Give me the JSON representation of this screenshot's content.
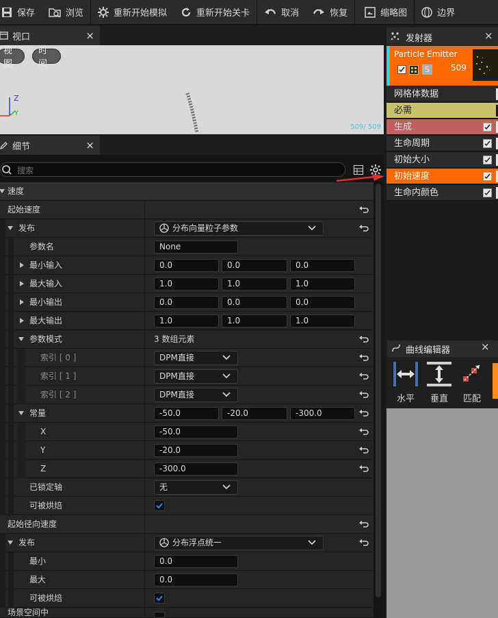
{
  "toolbar": {
    "items": [
      {
        "label": "保存",
        "icon": "save-icon"
      },
      {
        "label": "浏览",
        "icon": "browse-icon"
      },
      {
        "label": "重新开始模拟",
        "icon": "restart-sim-icon"
      },
      {
        "label": "重新开始关卡",
        "icon": "restart-level-icon"
      },
      {
        "label": "取消",
        "icon": "undo-icon"
      },
      {
        "label": "恢复",
        "icon": "redo-icon"
      },
      {
        "label": "缩略图",
        "icon": "thumbnail-icon"
      },
      {
        "label": "边界",
        "icon": "bounds-icon"
      }
    ]
  },
  "viewport": {
    "tab_title": "视口",
    "view_button": "视图",
    "time_button": "时间",
    "axis_z": "Z",
    "axis_y": "Y",
    "counter": "509/ 509"
  },
  "details": {
    "tab_title": "细节",
    "search_placeholder": "搜索",
    "section_velocity": "速度",
    "start_velocity": "起始速度",
    "distribution": "发布",
    "distribution_value": "分布向量粒子参数",
    "param_name": "参数名",
    "param_name_value": "None",
    "min_input": "最小输入",
    "min_input_values": [
      "0.0",
      "0.0",
      "0.0"
    ],
    "max_input": "最大输入",
    "max_input_values": [
      "1.0",
      "1.0",
      "1.0"
    ],
    "min_output": "最小输出",
    "min_output_values": [
      "0.0",
      "0.0",
      "0.0"
    ],
    "max_output": "最大输出",
    "max_output_values": [
      "1.0",
      "1.0",
      "1.0"
    ],
    "param_modes": "参数模式",
    "param_modes_value": "3 数组元素",
    "indices": [
      {
        "label": "索引 [ 0 ]",
        "value": "DPM直接"
      },
      {
        "label": "索引 [ 1 ]",
        "value": "DPM直接"
      },
      {
        "label": "索引 [ 2 ]",
        "value": "DPM直接"
      }
    ],
    "constant": "常量",
    "constant_values": [
      "-50.0",
      "-20.0",
      "-300.0"
    ],
    "x_label": "X",
    "x_value": "-50.0",
    "y_label": "Y",
    "y_value": "-20.0",
    "z_label": "Z",
    "z_value": "-300.0",
    "locked_axis": "已锁定轴",
    "locked_axis_value": "无",
    "can_bake": "可被烘焙",
    "start_radial": "起始径向速度",
    "radial_distribution": "发布",
    "radial_distribution_value": "分布浮点统一",
    "min_label": "最小",
    "min_value": "0.0",
    "max_label": "最大",
    "max_value": "0.0",
    "can_bake_2": "可被烘焙",
    "scene_space": "场景空间中"
  },
  "emitter": {
    "panel_title": "发射器",
    "emitter_name": "Particle Emitter",
    "s_badge": "S",
    "particle_count": "509",
    "modules": [
      {
        "label": "网格体数据",
        "color": "#2b2b2b",
        "checkbox": false
      },
      {
        "label": "必需",
        "color": "#c9c46b",
        "checkbox": false,
        "text_color": "#1b1b1b"
      },
      {
        "label": "生成",
        "color": "#c06060",
        "checkbox": true
      },
      {
        "label": "生命周期",
        "color": "#2b2b2b",
        "checkbox": true
      },
      {
        "label": "初始大小",
        "color": "#2b2b2b",
        "checkbox": true
      },
      {
        "label": "初始速度",
        "color": "#ff6a00",
        "checkbox": true
      },
      {
        "label": "生命内颜色",
        "color": "#2b2b2b",
        "checkbox": true
      }
    ]
  },
  "curve_editor": {
    "panel_title": "曲线编辑器",
    "horizontal": "水平",
    "vertical": "垂直",
    "fit": "匹配"
  },
  "colors": {
    "accent_orange": "#ff6a00",
    "required_yellow": "#c9c46b",
    "spawn_red": "#c06060",
    "annotation_red": "#e03030",
    "selection_blue": "#1a8cff"
  }
}
